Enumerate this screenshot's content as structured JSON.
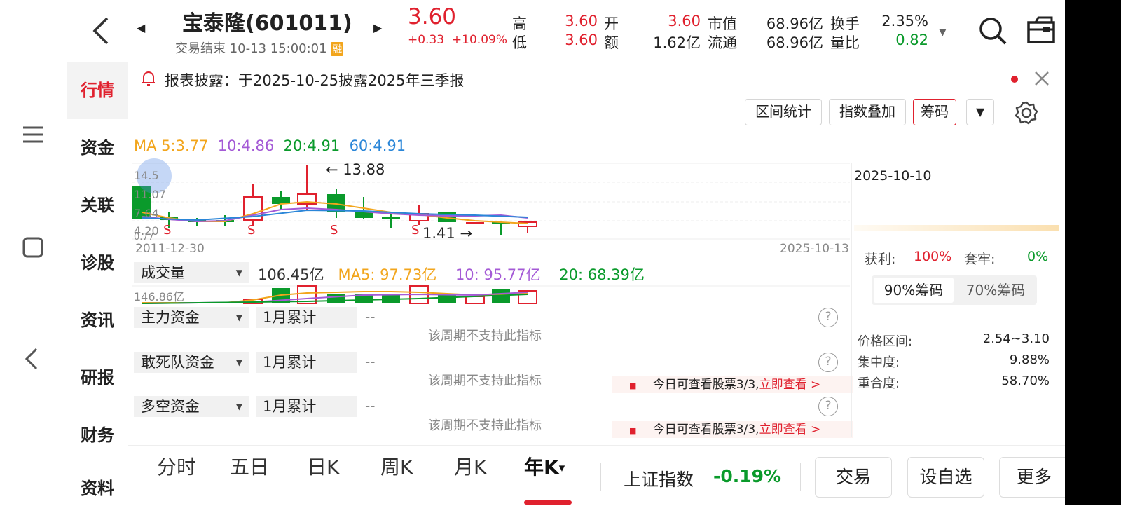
{
  "header": {
    "stock_name": "宝泰隆(601011)",
    "status": "交易结束 10-13 15:00:01",
    "margin_badge": "融",
    "price": "3.60",
    "change": "+0.33",
    "change_pct": "+10.09%",
    "quotes": [
      {
        "label": "高",
        "value": "3.60",
        "color": "red"
      },
      {
        "label": "低",
        "value": "3.60",
        "color": "red"
      },
      {
        "label": "开",
        "value": "3.60",
        "color": "red"
      },
      {
        "label": "额",
        "value": "1.62亿",
        "color": "black"
      },
      {
        "label": "市值",
        "value": "68.96亿",
        "color": "black"
      },
      {
        "label": "流通",
        "value": "68.96亿",
        "color": "black"
      },
      {
        "label": "换手",
        "value": "2.35%",
        "color": "black"
      },
      {
        "label": "量比",
        "value": "0.82",
        "color": "green"
      }
    ]
  },
  "side_tabs": [
    "行情",
    "资金",
    "关联",
    "诊股",
    "资讯",
    "研报",
    "财务",
    "资料"
  ],
  "notice": {
    "text": "报表披露：于2025-10-25披露2025年三季报"
  },
  "toolbar": {
    "interval_stats": "区间统计",
    "index_overlay": "指数叠加",
    "chips": "筹码"
  },
  "ma_line": {
    "ma5": "MA 5:3.77",
    "ma10": "10:4.86",
    "ma20": "20:4.91",
    "ma60": "60:4.91"
  },
  "kline": {
    "y_labels": [
      "14.5",
      "11.07",
      "7.64",
      "4.20",
      "0.77"
    ],
    "high_annot": "13.88",
    "low_annot": "1.41",
    "start_date": "2011-12-30",
    "end_date": "2025-10-13"
  },
  "volume": {
    "selector": "成交量",
    "value": "106.45亿",
    "ma5": "MA5: 97.73亿",
    "ma10": "10: 95.77亿",
    "ma20": "20: 68.39亿",
    "max_label": "146.86亿"
  },
  "indicators": [
    {
      "name": "主力资金",
      "period": "1月累计",
      "value": "--",
      "hint": "该周期不支持此指标",
      "unlock": ""
    },
    {
      "name": "敢死队资金",
      "period": "1月累计",
      "value": "--",
      "hint": "该周期不支持此指标",
      "unlock": "今日可查看股票3/3,",
      "unlock_link": "立即查看 >"
    },
    {
      "name": "多空资金",
      "period": "1月累计",
      "value": "--",
      "hint": "该周期不支持此指标",
      "unlock": "今日可查看股票3/3,",
      "unlock_link": "立即查看 >"
    }
  ],
  "chips_panel": {
    "date": "2025-10-10",
    "profit_label": "获利:",
    "profit_value": "100%",
    "trapped_label": "套牢:",
    "trapped_value": "0%",
    "tab_90": "90%筹码",
    "tab_70": "70%筹码",
    "price_range_label": "价格区间:",
    "price_range_value": "2.54~3.10",
    "concentration_label": "集中度:",
    "concentration_value": "9.88%",
    "overlap_label": "重合度:",
    "overlap_value": "58.70%"
  },
  "bottom_tabs": [
    "分时",
    "五日",
    "日K",
    "周K",
    "月K",
    "年K"
  ],
  "index_name": "上证指数",
  "index_change": "-0.19%",
  "bottom_buttons": {
    "trade": "交易",
    "add_watch": "设自选",
    "more": "更多"
  },
  "colors": {
    "up": "#e0212e",
    "down": "#0a9a2b",
    "ma5": "#f2a51c",
    "ma10": "#a45ad6",
    "ma20": "#0a9a2b",
    "ma60": "#2a86d8"
  }
}
